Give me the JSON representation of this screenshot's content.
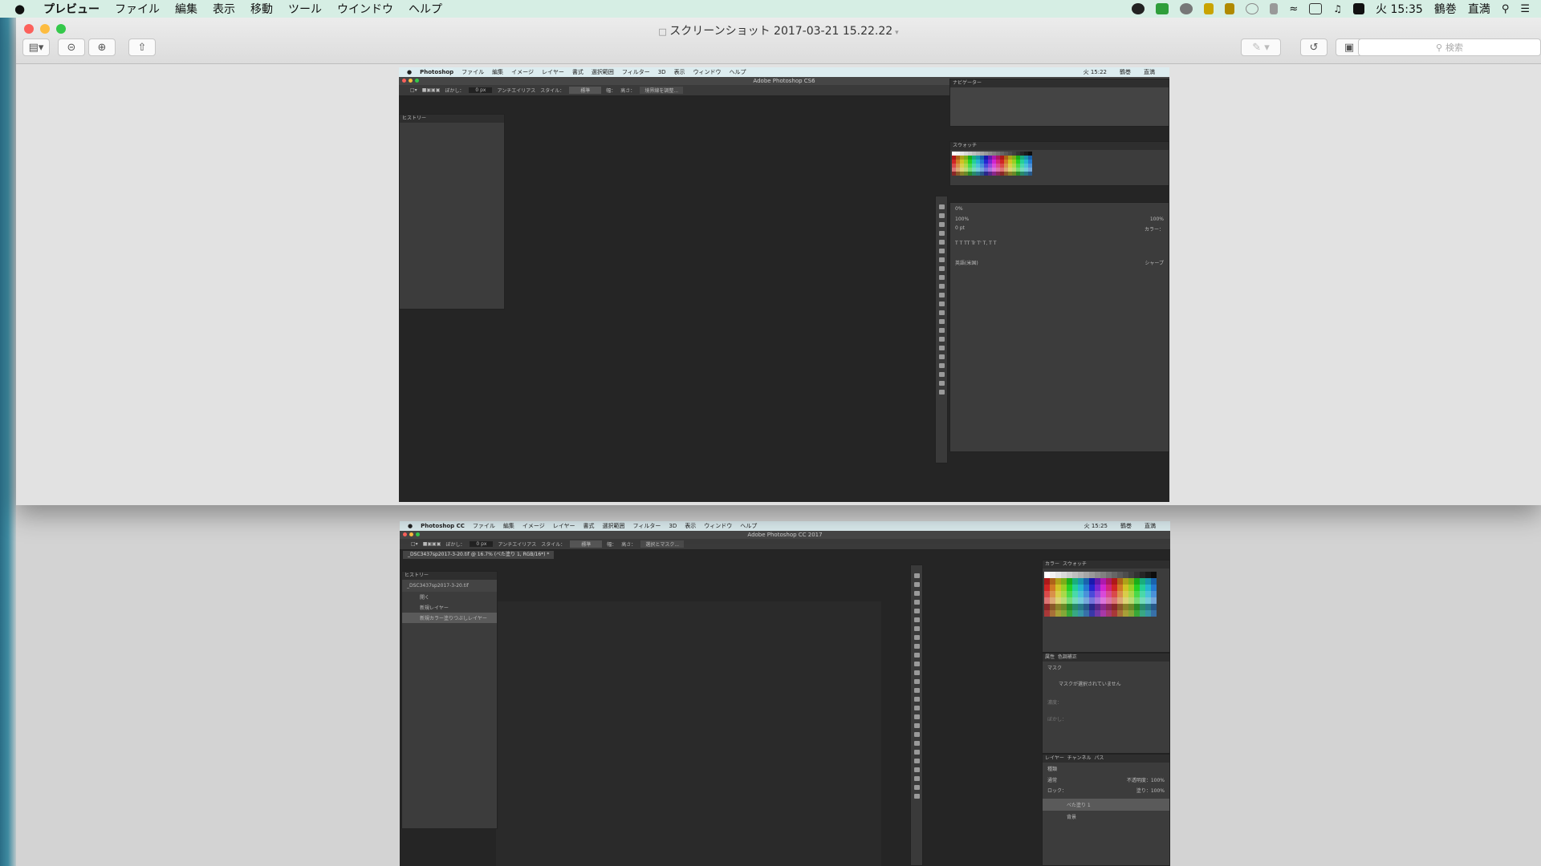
{
  "menubar": {
    "apple": "",
    "items": [
      "プレビュー",
      "ファイル",
      "編集",
      "表示",
      "移動",
      "ツール",
      "ウインドウ",
      "ヘルプ"
    ],
    "clock": "火 15:35",
    "input": "鶴巻",
    "user": "直満"
  },
  "preview": {
    "title": "スクリーンショット 2017-03-21 15.22.22",
    "search_placeholder": "検索"
  },
  "ps6": {
    "menu": [
      "Photoshop",
      "ファイル",
      "編集",
      "イメージ",
      "レイヤー",
      "書式",
      "選択範囲",
      "フィルター",
      "3D",
      "表示",
      "ウィンドウ",
      "ヘルプ"
    ],
    "clock": "火 15:22",
    "input": "鶴巻",
    "user": "直満",
    "window_title": "Adobe Photoshop CS6",
    "opt": {
      "feather": "ぼかし：",
      "feather_val": "0 px",
      "anti": "アンチエイリアス",
      "style": "スタイル：",
      "style_val": "標準",
      "w": "幅：",
      "h": "高さ：",
      "refine": "境界線を調整..."
    },
    "history": "ヒストリー",
    "navigator": "ナビゲーター",
    "swatches": "スウォッチ",
    "char": {
      "pct0": "0%",
      "pct100a": "100%",
      "pct100b": "100%",
      "pt": "0 pt",
      "color": "カラー：",
      "lang": "英語(米国)",
      "aa": "シャープ"
    }
  },
  "pscc": {
    "menu": [
      "Photoshop CC",
      "ファイル",
      "編集",
      "イメージ",
      "レイヤー",
      "書式",
      "選択範囲",
      "フィルター",
      "3D",
      "表示",
      "ウィンドウ",
      "ヘルプ"
    ],
    "clock": "火 15:25",
    "input": "鶴巻",
    "user": "直満",
    "window_title": "Adobe Photoshop CC 2017",
    "opt": {
      "feather": "ぼかし：",
      "feather_val": "0 px",
      "anti": "アンチエイリアス",
      "style": "スタイル：",
      "style_val": "標準",
      "w": "幅：",
      "h": "高さ：",
      "mask": "選択とマスク..."
    },
    "doc_tab": "_DSC3437sp2017-3-20.tif @ 16.7% (べた塗り 1, RGB/16*) *",
    "history": "ヒストリー",
    "history_items": [
      "_DSC3437sp2017-3-20.tif",
      "開く",
      "新規レイヤー",
      "新規カラー塗りつぶしレイヤー"
    ],
    "color_tabs": [
      "カラー",
      "スウォッチ"
    ],
    "props_tabs": [
      "属性",
      "色調補正"
    ],
    "mask": "マスク",
    "no_mask": "マスクが選択されていません",
    "density": "濃度：",
    "feather2": "ぼかし：",
    "layers_tabs": [
      "レイヤー",
      "チャンネル",
      "パス"
    ],
    "kind": "種類",
    "blend": "通常",
    "opacity": "不透明度：",
    "opacity_val": "100%",
    "lock": "ロック：",
    "fill": "塗り：",
    "fill_val": "100%",
    "layers": [
      "べた塗り 1",
      "背景"
    ]
  }
}
